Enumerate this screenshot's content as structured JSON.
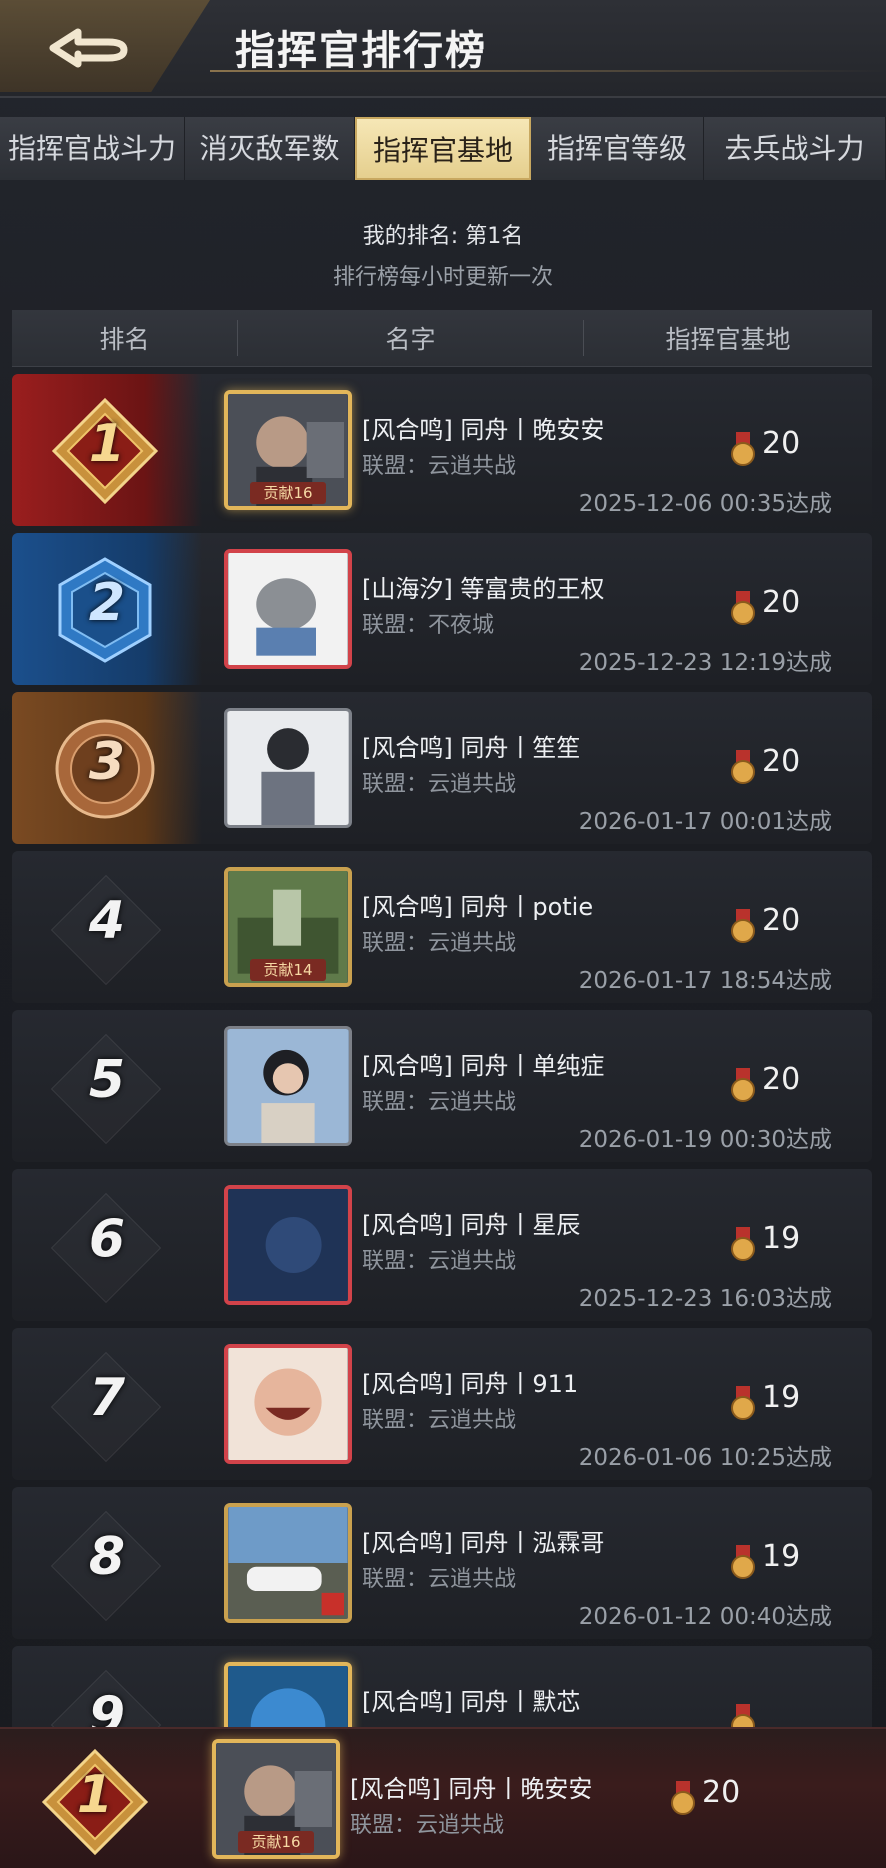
{
  "header": {
    "title": "指挥官排行榜"
  },
  "tabs": [
    {
      "label": "指挥官战斗力"
    },
    {
      "label": "消灭敌军数"
    },
    {
      "label": "指挥官基地",
      "active": true
    },
    {
      "label": "指挥官等级"
    },
    {
      "label": "去兵战斗力"
    }
  ],
  "summary": {
    "my_rank": "我的排名: 第1名",
    "update_note": "排行榜每小时更新一次"
  },
  "columns": {
    "rank": "排名",
    "name": "名字",
    "base": "指挥官基地"
  },
  "rows": [
    {
      "rank": "1",
      "name": "[风合鸣] 同舟丨晚安安",
      "alliance": "联盟：云逍共战",
      "score": "20",
      "time": "2025-12-06 00:35达成",
      "badge": "贡献16"
    },
    {
      "rank": "2",
      "name": "[山海汐] 等富贵的王权",
      "alliance": "联盟：不夜城",
      "score": "20",
      "time": "2025-12-23 12:19达成"
    },
    {
      "rank": "3",
      "name": "[风合鸣] 同舟丨笙笙",
      "alliance": "联盟：云逍共战",
      "score": "20",
      "time": "2026-01-17 00:01达成"
    },
    {
      "rank": "4",
      "name": "[风合鸣] 同舟丨potie",
      "alliance": "联盟：云逍共战",
      "score": "20",
      "time": "2026-01-17 18:54达成",
      "badge": "贡献14"
    },
    {
      "rank": "5",
      "name": "[风合鸣] 同舟丨单纯症",
      "alliance": "联盟：云逍共战",
      "score": "20",
      "time": "2026-01-19 00:30达成"
    },
    {
      "rank": "6",
      "name": "[风合鸣] 同舟丨星辰",
      "alliance": "联盟：云逍共战",
      "score": "19",
      "time": "2025-12-23 16:03达成"
    },
    {
      "rank": "7",
      "name": "[风合鸣] 同舟丨911",
      "alliance": "联盟：云逍共战",
      "score": "19",
      "time": "2026-01-06 10:25达成"
    },
    {
      "rank": "8",
      "name": "[风合鸣] 同舟丨泓霖哥",
      "alliance": "联盟：云逍共战",
      "score": "19",
      "time": "2026-01-12 00:40达成"
    },
    {
      "rank": "9",
      "name": "[风合鸣] 同舟丨默芯",
      "alliance": "",
      "score": "",
      "time": ""
    }
  ],
  "my_entry": {
    "rank": "1",
    "name": "[风合鸣] 同舟丨晚安安",
    "alliance": "联盟：云逍共战",
    "score": "20",
    "badge": "贡献16"
  },
  "colors": {
    "gold": "#c9a14f",
    "red_rank": "#9a1e1e",
    "blue_rank": "#1b4f8c",
    "bronze_rank": "#7a4a22"
  }
}
